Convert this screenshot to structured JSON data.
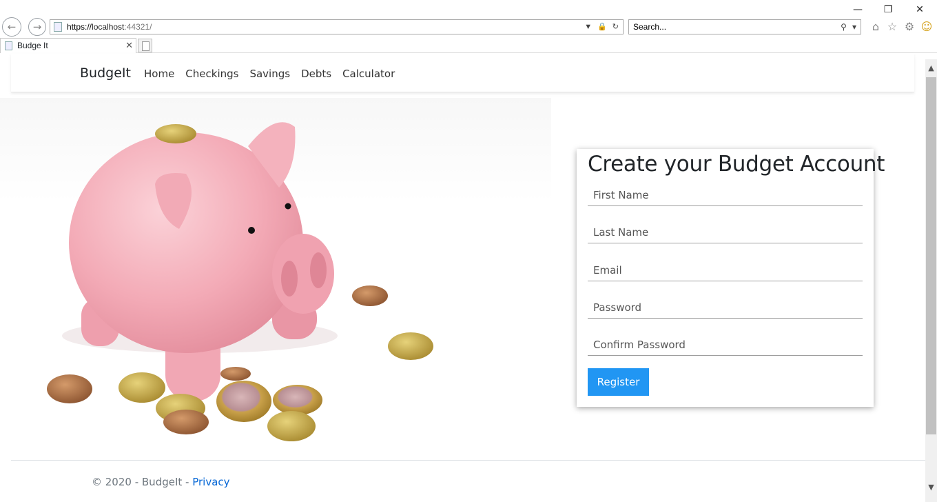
{
  "browser": {
    "url_protocol": "https://",
    "url_host": "localhost",
    "url_port": ":44321/",
    "search_placeholder": "Search...",
    "tab_title": "Budge It",
    "icons": [
      "back-icon",
      "forward-icon",
      "minimize-icon",
      "restore-icon",
      "close-icon",
      "home-icon",
      "favorites-icon",
      "settings-icon",
      "smiley-icon",
      "lock-icon",
      "refresh-icon",
      "search-icon"
    ]
  },
  "nav": {
    "brand": "BudgeIt",
    "links": [
      "Home",
      "Checkings",
      "Savings",
      "Debts",
      "Calculator"
    ]
  },
  "form": {
    "title": "Create your Budget Account",
    "fields": {
      "first_name": "First Name",
      "last_name": "Last Name",
      "email": "Email",
      "password": "Password",
      "confirm_password": "Confirm Password"
    },
    "register_label": "Register",
    "accent_color": "#2196f3"
  },
  "footer": {
    "text": "© 2020 - BudgeIt - ",
    "privacy_label": "Privacy"
  }
}
